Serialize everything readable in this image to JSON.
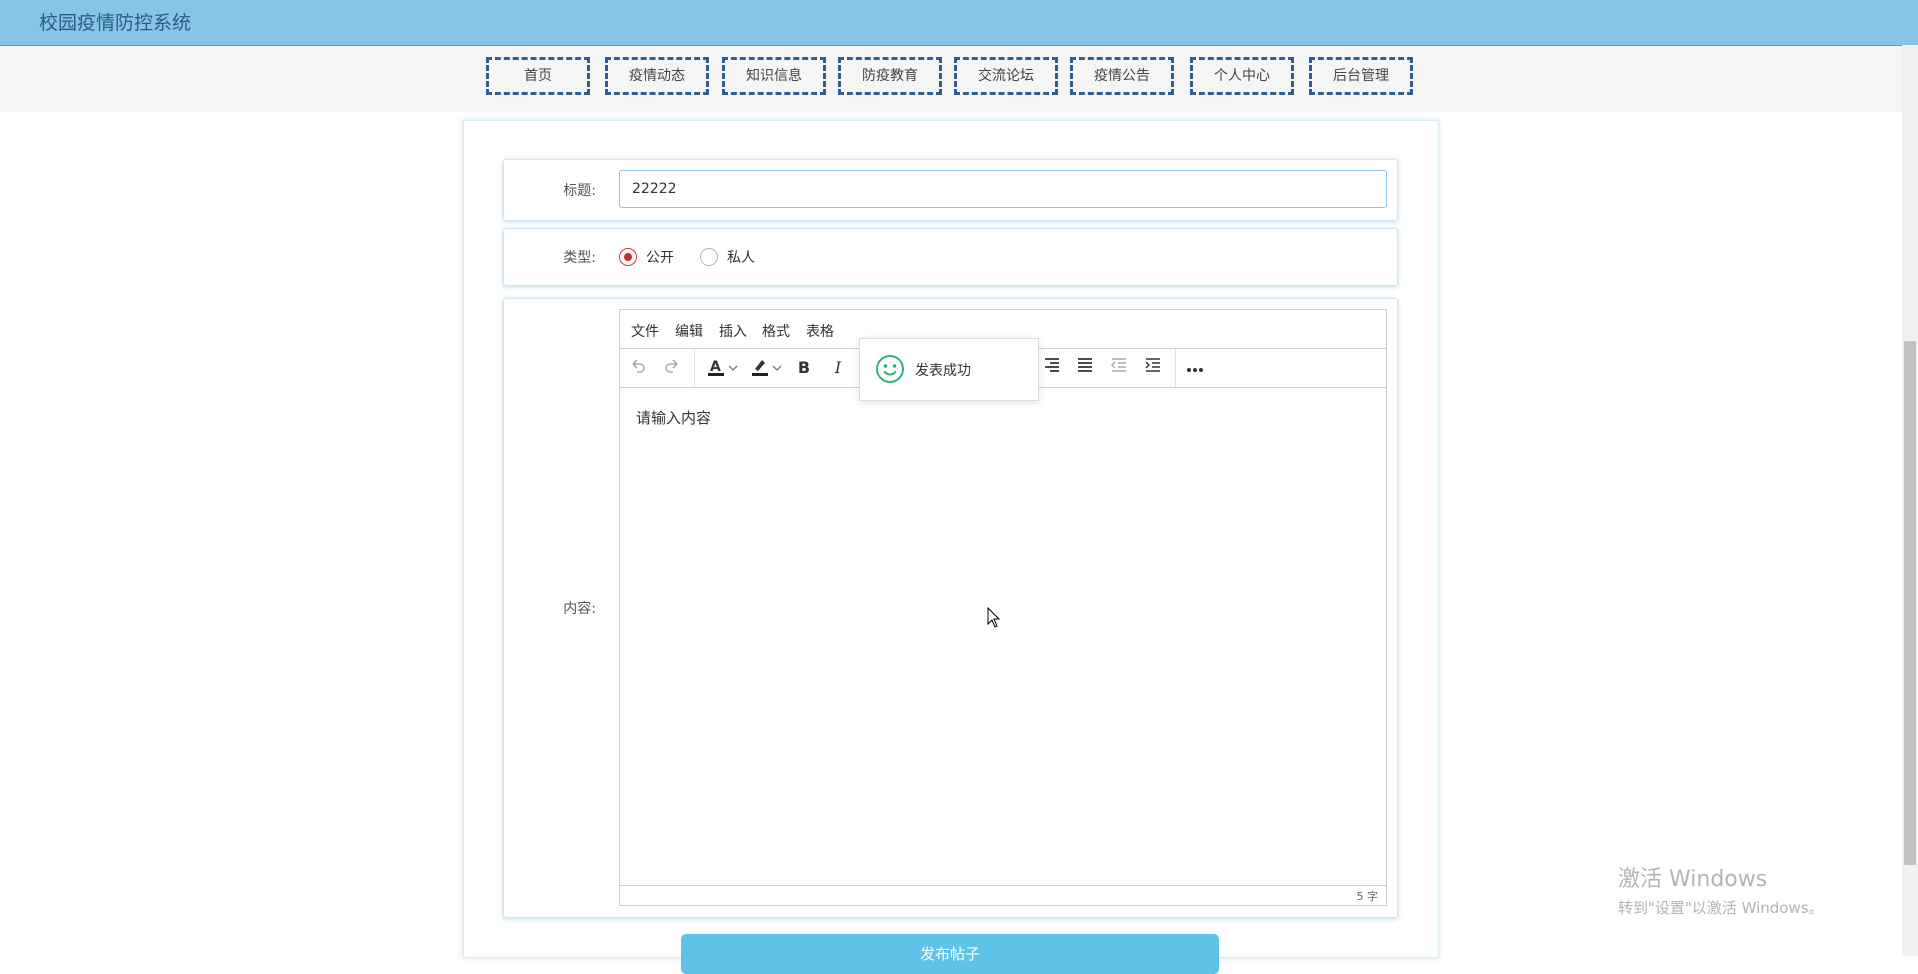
{
  "app": {
    "title": "校园疫情防控系统"
  },
  "nav": [
    "首页",
    "疫情动态",
    "知识信息",
    "防疫教育",
    "交流论坛",
    "疫情公告",
    "个人中心",
    "后台管理"
  ],
  "form": {
    "title_label": "标题:",
    "title_value": "22222",
    "type_label": "类型:",
    "type_options": [
      "公开",
      "私人"
    ],
    "type_selected": "公开",
    "content_label": "内容:"
  },
  "editor": {
    "menus": [
      "文件",
      "编辑",
      "插入",
      "格式",
      "表格"
    ],
    "toolbar": {
      "undo": "undo-icon",
      "redo": "redo-icon",
      "text_color": "text-color-icon",
      "highlight": "highlight-icon",
      "bold": "B",
      "italic": "I",
      "align_right": "align-right-icon",
      "justify": "justify-icon",
      "outdent": "outdent-icon",
      "indent": "indent-icon",
      "more": "more-icon"
    },
    "placeholder": "请输入内容",
    "word_count": "5 字"
  },
  "toast": {
    "message": "发表成功",
    "icon": "smile-icon"
  },
  "submit_label": "发布帖子",
  "watermark": {
    "line1": "激活 Windows",
    "line2": "转到\"设置\"以激活 Windows。"
  },
  "colors": {
    "header_bg": "#86c5e6",
    "nav_border": "#2e5f93",
    "radio_active": "#c92a2a",
    "submit_bg": "#5fc3e8",
    "toast_icon": "#2bb673"
  }
}
